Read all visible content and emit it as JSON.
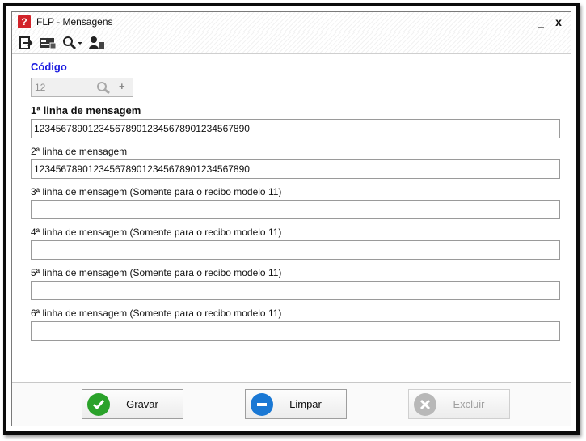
{
  "window": {
    "app_icon": "flp-logo-icon",
    "title": "FLP - Mensagens",
    "minimize_glyph": "_",
    "close_glyph": "x"
  },
  "toolbar": {
    "icons": [
      "exit-icon",
      "id-card-icon",
      "search-dropdown-icon",
      "user-icon"
    ]
  },
  "form": {
    "code_label": "Código",
    "code_value": "12",
    "line1_label": "1ª linha de mensagem",
    "line1_value": "1234567890123456789012345678901234567890",
    "line2_label": "2ª linha de mensagem",
    "line2_value": "1234567890123456789012345678901234567890",
    "line3_label": "3ª linha de mensagem (Somente  para o recibo modelo  11)",
    "line3_value": "",
    "line4_label": "4ª linha de mensagem (Somente  para o recibo modelo  11)",
    "line4_value": "",
    "line5_label": "5ª linha de mensagem (Somente  para o recibo modelo  11)",
    "line5_value": "",
    "line6_label": "6ª linha de mensagem (Somente  para o recibo modelo  11)",
    "line6_value": ""
  },
  "footer": {
    "save_label": "Gravar",
    "clear_label": "Limpar",
    "delete_label": "Excluir"
  },
  "colors": {
    "code_label": "#1b1be0",
    "save_green": "#2aa22a",
    "clear_blue": "#1a78d4",
    "delete_gray": "#b8b8b8",
    "app_red": "#d2232a"
  }
}
